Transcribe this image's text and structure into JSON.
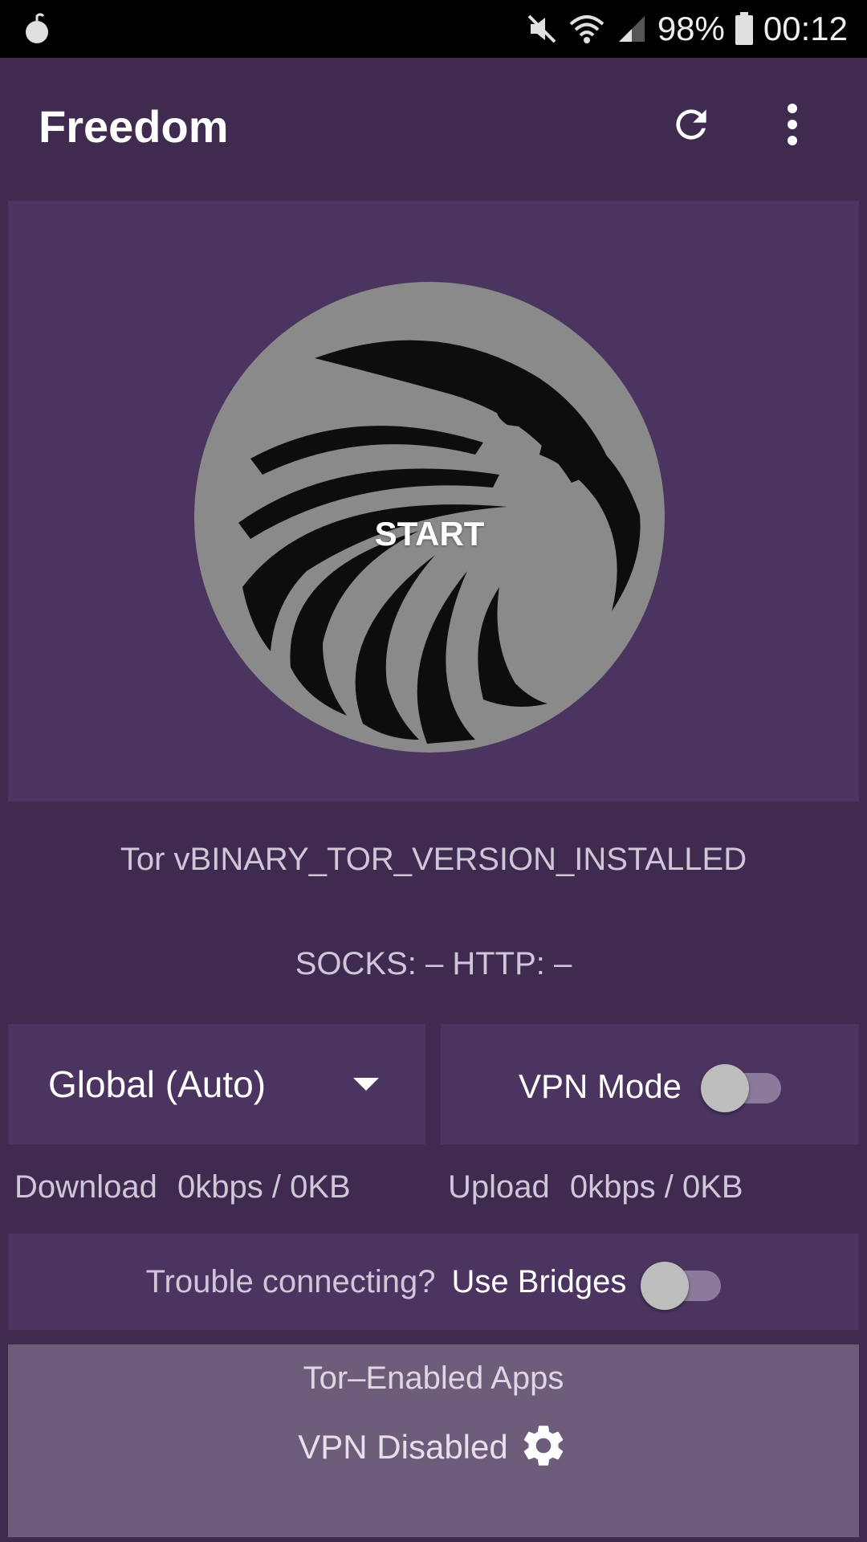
{
  "status_bar": {
    "battery": "98%",
    "time": "00:12",
    "icons": [
      "notification-bomb-icon",
      "mute-icon",
      "wifi-icon",
      "signal-icon",
      "battery-icon"
    ]
  },
  "app_bar": {
    "title": "Freedom",
    "actions": [
      "refresh-icon",
      "more-vert-icon"
    ]
  },
  "hero": {
    "start_label": "START",
    "button_color": "#8a8a8a",
    "background": "#4b3560"
  },
  "info": {
    "tor_version": "Tor vBINARY_TOR_VERSION_INSTALLED",
    "proxy_ports": "SOCKS: – HTTP: –"
  },
  "controls": {
    "mode_selected": "Global (Auto)",
    "vpn_label": "VPN Mode",
    "vpn_enabled": false
  },
  "bandwidth": {
    "download_label": "Download",
    "download_value": "0kbps / 0KB",
    "upload_label": "Upload",
    "upload_value": "0kbps / 0KB"
  },
  "bridges": {
    "prompt": "Trouble connecting?",
    "label": "Use Bridges",
    "enabled": false
  },
  "apps": {
    "title": "Tor–Enabled Apps",
    "vpn_status": "VPN Disabled"
  },
  "colors": {
    "page_bg": "#3f2b4f",
    "panel_bg": "#4b3560",
    "apps_panel_bg": "#6d5d7a"
  }
}
